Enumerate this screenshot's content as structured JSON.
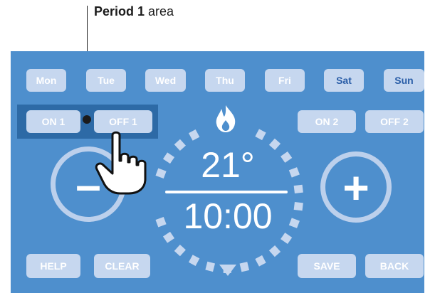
{
  "callout": {
    "bold": "Period 1",
    "rest": " area"
  },
  "days": [
    "Mon",
    "Tue",
    "Wed",
    "Thu",
    "Fri",
    "Sat",
    "Sun"
  ],
  "period1": {
    "on": "ON 1",
    "off": "OFF 1"
  },
  "period2": {
    "on": "ON 2",
    "off": "OFF 2"
  },
  "controls": {
    "minus": "–",
    "plus": "+",
    "help": "HELP",
    "clear": "CLEAR",
    "save": "SAVE",
    "back": "BACK"
  },
  "display": {
    "temperature": "21°",
    "time": "10:00"
  },
  "icons": {
    "flame": "flame-icon",
    "pointer": "pointing-hand-icon",
    "dial_marker": "triangle-marker-icon"
  },
  "colors": {
    "panel": "#4e8fcd",
    "period_highlight": "#2d6aa6",
    "button": "#c6d7ef",
    "button_text_selected": "#2a5ea8",
    "ring": "#bcd0ec",
    "text": "#ffffff"
  }
}
